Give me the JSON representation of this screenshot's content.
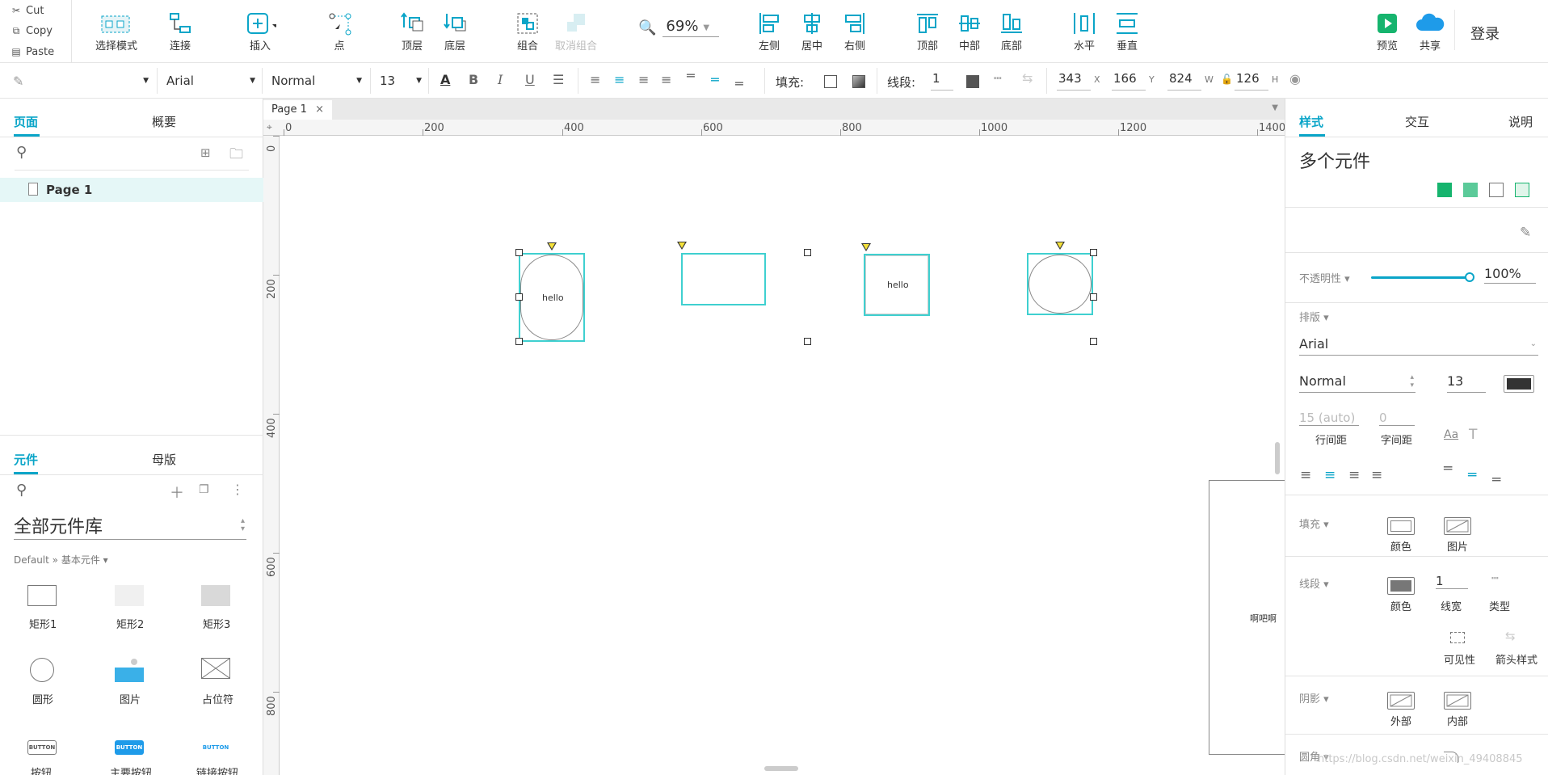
{
  "clipboard": {
    "cut": "Cut",
    "copy": "Copy",
    "paste": "Paste"
  },
  "toolbar": {
    "select_mode": "选择模式",
    "connect": "连接",
    "insert": "插入",
    "point": "点",
    "top_layer": "顶层",
    "bottom_layer": "底层",
    "group": "组合",
    "ungroup": "取消组合",
    "zoom": "69%",
    "align_left": "左侧",
    "align_center": "居中",
    "align_right": "右侧",
    "align_top": "顶部",
    "align_middle": "中部",
    "align_bottom": "底部",
    "distribute_h": "水平",
    "distribute_v": "垂直",
    "preview": "预览",
    "share": "共享",
    "login": "登录"
  },
  "format_bar": {
    "font": "Arial",
    "weight": "Normal",
    "size": "13",
    "fill_label": "填充:",
    "stroke_label": "线段:",
    "stroke_value": "1",
    "x": "343",
    "x_lbl": "X",
    "y": "166",
    "y_lbl": "Y",
    "w": "824",
    "w_lbl": "W",
    "h": "126",
    "h_lbl": "H"
  },
  "left_panel": {
    "tabs": [
      "页面",
      "概要"
    ],
    "pages": [
      {
        "label": "Page 1"
      }
    ],
    "lib_tabs": [
      "元件",
      "母版"
    ],
    "library_title": "全部元件库",
    "breadcrumb": "Default » 基本元件 ▾",
    "widgets": [
      {
        "label": "矩形1",
        "icon": "rect1-icon"
      },
      {
        "label": "矩形2",
        "icon": "rect2-icon"
      },
      {
        "label": "矩形3",
        "icon": "rect3-icon"
      },
      {
        "label": "圆形",
        "icon": "circle-icon"
      },
      {
        "label": "图片",
        "icon": "image-icon"
      },
      {
        "label": "占位符",
        "icon": "placeholder-icon"
      },
      {
        "label": "按钮",
        "icon": "button-icon",
        "icon_text": "BUTTON"
      },
      {
        "label": "主要按钮",
        "icon": "primary-button-icon",
        "icon_text": "BUTTON"
      },
      {
        "label": "链接按钮",
        "icon": "link-button-icon",
        "icon_text": "BUTTON"
      }
    ]
  },
  "canvas": {
    "tab": "Page 1",
    "ruler_h": [
      "0",
      "200",
      "400",
      "600",
      "800",
      "1000",
      "1200",
      "1400"
    ],
    "ruler_v": [
      "0",
      "200",
      "400",
      "600",
      "800"
    ],
    "shape_text_1": "hello",
    "shape_text_2": "hello",
    "side_text": "啊吧啊"
  },
  "right_panel": {
    "tabs": [
      "样式",
      "交互",
      "说明"
    ],
    "title": "多个元件",
    "opacity_label": "不透明性 ▾",
    "opacity_value": "100%",
    "opacity": 1.0,
    "typography_label": "排版 ▾",
    "font": "Arial",
    "weight": "Normal",
    "size": "13",
    "line_height_value": "15 (auto)",
    "line_height_label": "行间距",
    "letter_spacing_value": "0",
    "letter_spacing_label": "字间距",
    "fill_label": "填充 ▾",
    "fill_color_label": "颜色",
    "fill_image_label": "图片",
    "stroke_label": "线段 ▾",
    "stroke_color_label": "颜色",
    "stroke_width_value": "1",
    "stroke_width_label": "线宽",
    "stroke_type_label": "类型",
    "visibility_label": "可见性",
    "arrow_label": "箭头样式",
    "shadow_label": "阴影 ▾",
    "shadow_outer": "外部",
    "shadow_inner": "内部",
    "corner_label": "圆角 ▾",
    "watermark": "https://blog.csdn.net/weixin_49408845"
  },
  "colors": {
    "accent": "#0aa5c8",
    "selection": "#3fd0d0",
    "brand_green": "#16b46e"
  }
}
